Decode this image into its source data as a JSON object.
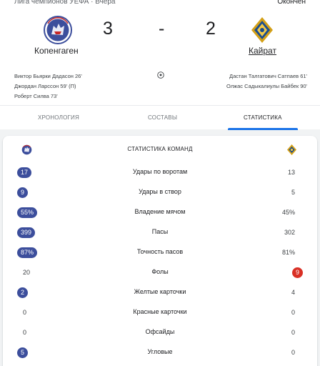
{
  "match": {
    "league_line": "Лига чемпионов УЕФА · Вчера",
    "status": "Окончен",
    "home": {
      "name": "Копенгаген",
      "score": "3",
      "logo": "fc-copenhagen-lion-logo",
      "color": "#3c4e9c"
    },
    "away": {
      "name": "Кайрат",
      "score": "2",
      "logo": "fc-kairat-crest-logo",
      "color": "#d4a017"
    },
    "dash": "-",
    "home_scorers": [
      "Виктор Бьярки Дадасон 26'",
      "Джордан Ларссон 59' (П)",
      "Роберт Силва 73'"
    ],
    "away_scorers": [
      "Дастан Талгатович Сатпаев 61'",
      "Олжас Садыкалиулы Байбек 90'"
    ]
  },
  "tabs": [
    {
      "label": "ХРОНОЛОГИЯ",
      "selected": false
    },
    {
      "label": "СОСТАВЫ",
      "selected": false
    },
    {
      "label": "СТАТИСТИКА",
      "selected": true
    }
  ],
  "stats": {
    "title": "СТАТИСТИКА КОМАНД",
    "highlight_colors": {
      "home": "#3c4e9c",
      "away": "#d93025"
    },
    "rows": [
      {
        "label": "Удары по воротам",
        "home": "17",
        "away": "13",
        "leader": "home"
      },
      {
        "label": "Удары в створ",
        "home": "9",
        "away": "5",
        "leader": "home"
      },
      {
        "label": "Владение мячом",
        "home": "55%",
        "away": "45%",
        "leader": "home"
      },
      {
        "label": "Пасы",
        "home": "399",
        "away": "302",
        "leader": "home"
      },
      {
        "label": "Точность пасов",
        "home": "87%",
        "away": "81%",
        "leader": "home"
      },
      {
        "label": "Фолы",
        "home": "20",
        "away": "9",
        "leader": "away"
      },
      {
        "label": "Желтые карточки",
        "home": "2",
        "away": "4",
        "leader": "home"
      },
      {
        "label": "Красные карточки",
        "home": "0",
        "away": "0",
        "leader": "none"
      },
      {
        "label": "Офсайды",
        "home": "0",
        "away": "0",
        "leader": "none"
      },
      {
        "label": "Угловые",
        "home": "5",
        "away": "0",
        "leader": "home"
      }
    ]
  }
}
